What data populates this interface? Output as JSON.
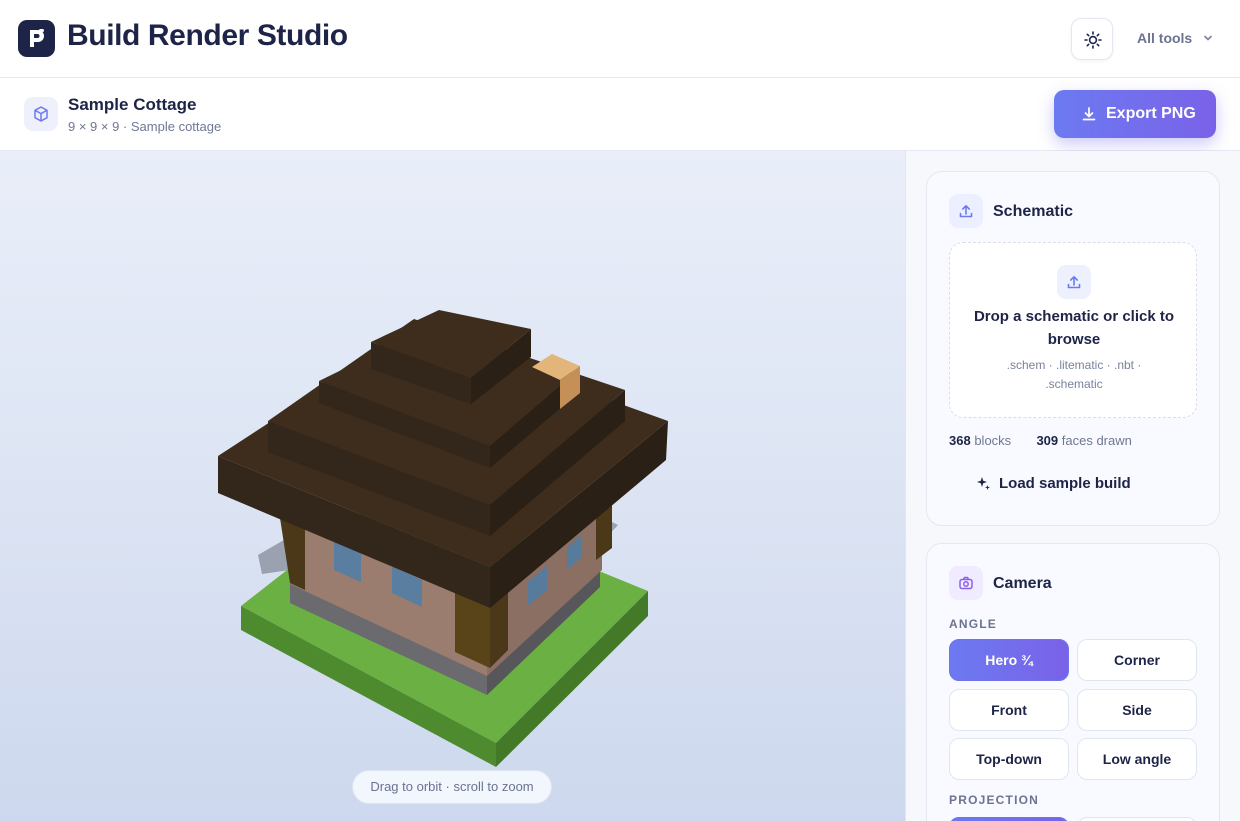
{
  "app": {
    "title": "Build Render Studio",
    "tools_menu": "All tools"
  },
  "build": {
    "name": "Sample Cottage",
    "meta": "9 × 9 × 9 · Sample cottage"
  },
  "toolbar": {
    "export_label": "Export PNG"
  },
  "viewport": {
    "hint": "Drag to orbit · scroll to zoom"
  },
  "schematic": {
    "title": "Schematic",
    "drop_title": "Drop a schematic or click to browse",
    "drop_formats": ".schem · .litematic · .nbt · .schematic",
    "blocks_count": "368",
    "blocks_label": "blocks",
    "faces_count": "309",
    "faces_label": "faces drawn",
    "sample_label": "Load sample build"
  },
  "camera": {
    "title": "Camera",
    "angle_label": "ANGLE",
    "angles": [
      "Hero ¾",
      "Corner",
      "Front",
      "Side",
      "Top-down",
      "Low angle"
    ],
    "selected_angle": "Hero ¾",
    "projection_label": "PROJECTION"
  },
  "colors": {
    "accent": "#6c7af0",
    "accent_end": "#7a62e8",
    "roof": "#3b2a1b",
    "grass": "#5a9a36"
  },
  "icons": [
    "app-logo-icon",
    "sun-icon",
    "chevron-down-icon",
    "cube-icon",
    "download-icon",
    "upload-icon",
    "sparkle-icon",
    "camera-icon"
  ]
}
